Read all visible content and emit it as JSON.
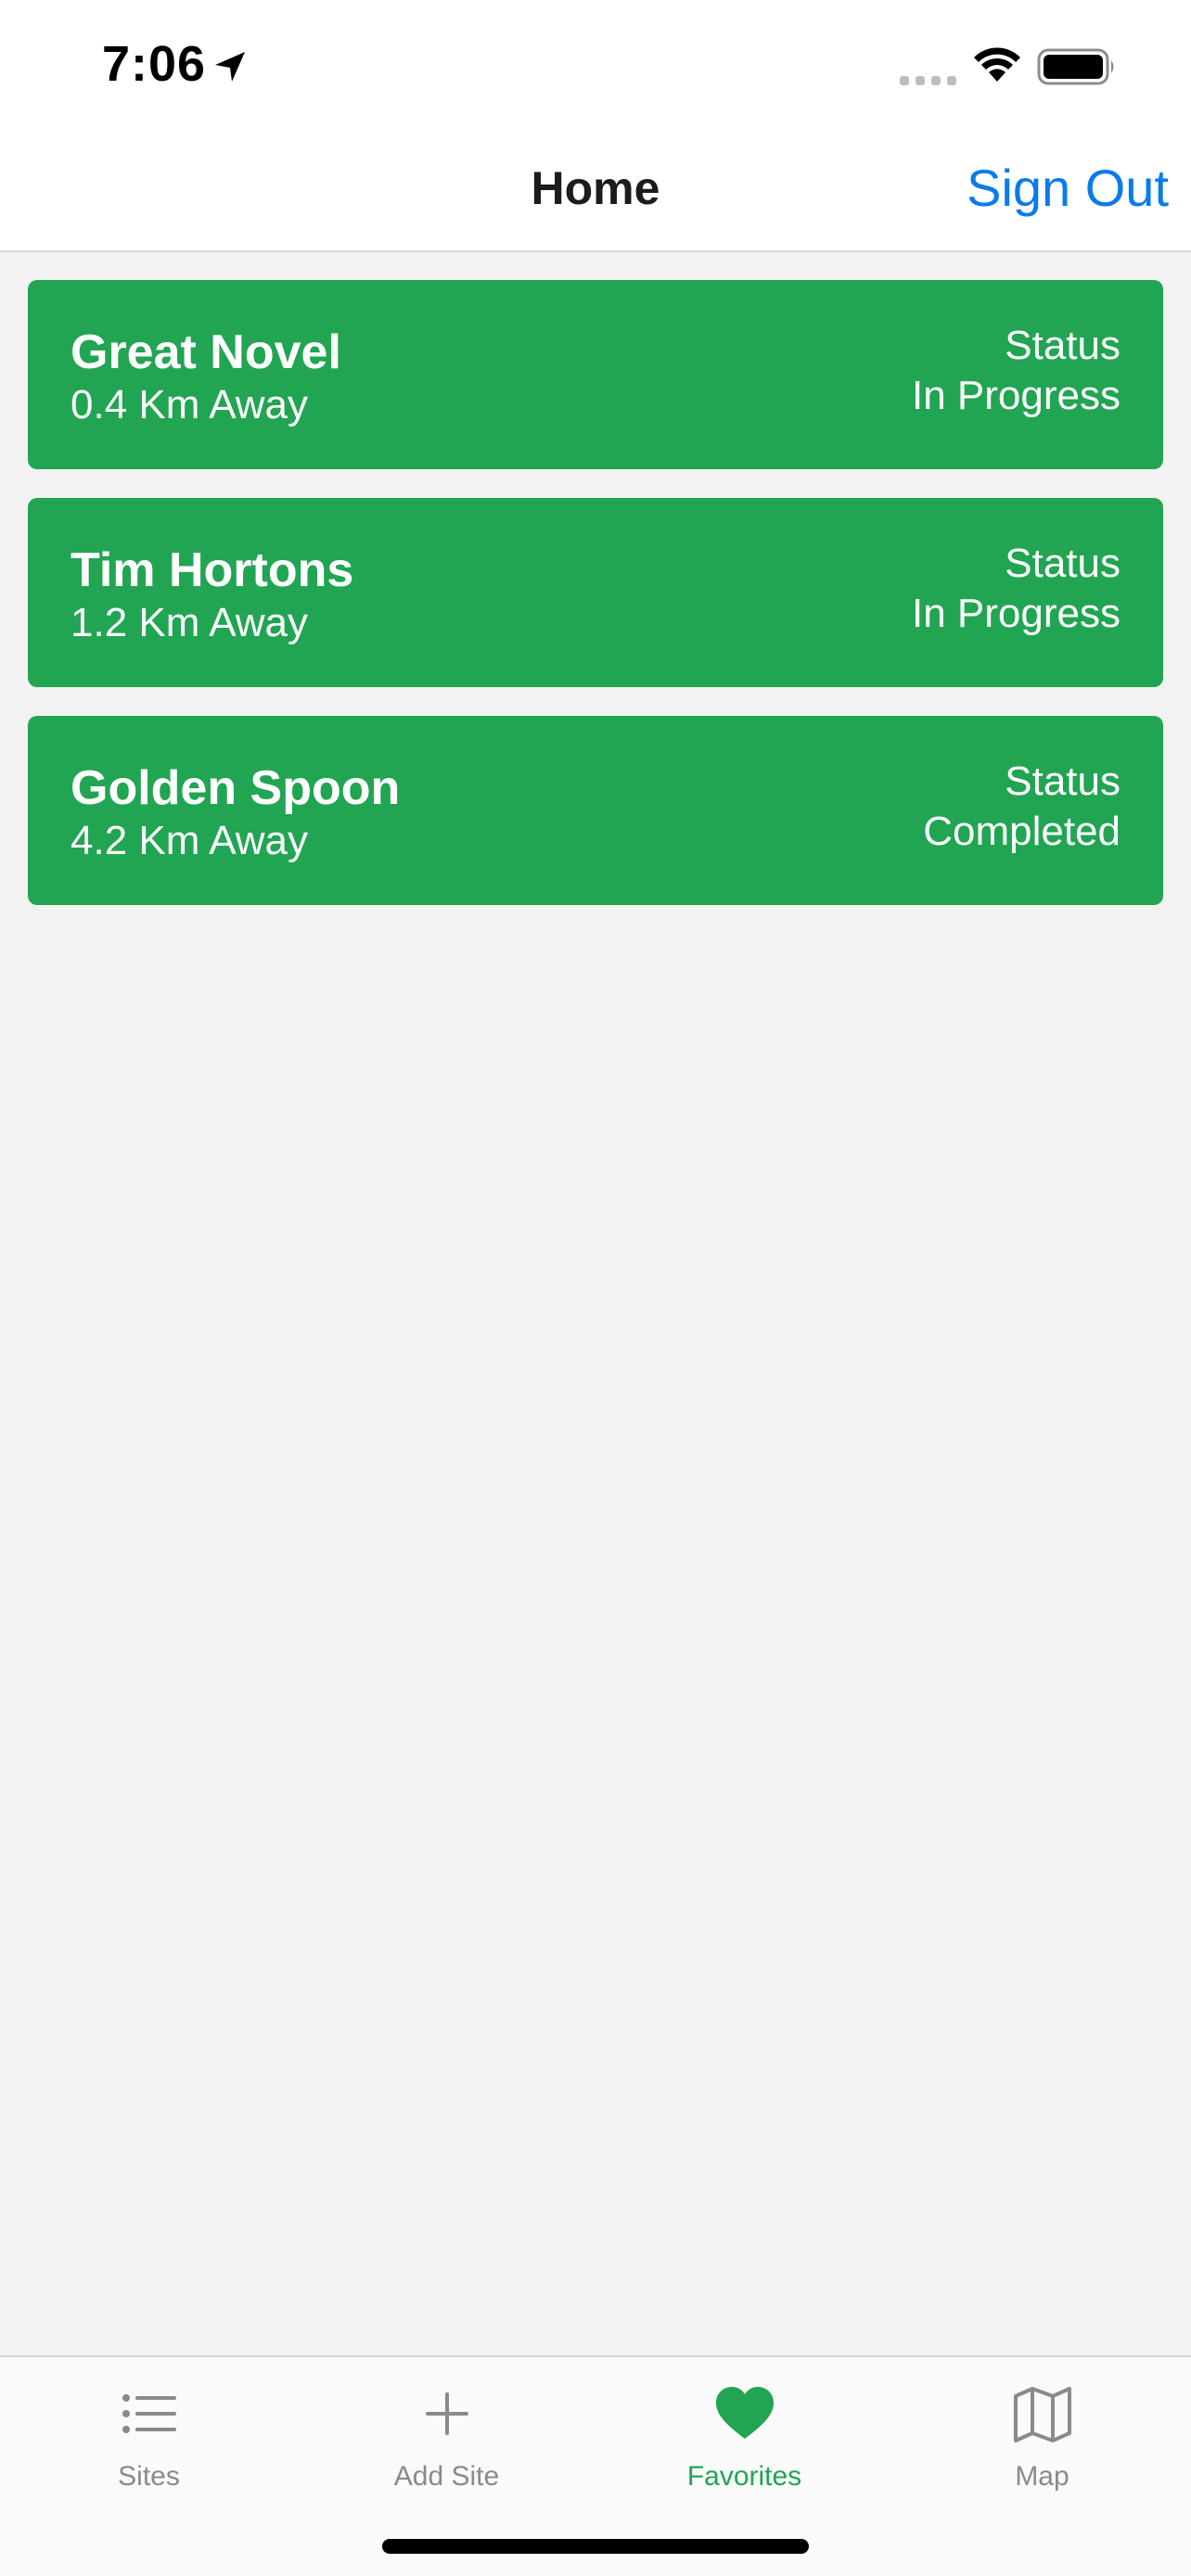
{
  "status_bar": {
    "time": "7:06"
  },
  "nav": {
    "title": "Home",
    "sign_out_label": "Sign Out"
  },
  "sites": [
    {
      "name": "Great Novel",
      "distance": "0.4 Km Away",
      "status_label": "Status",
      "status": "In Progress"
    },
    {
      "name": "Tim Hortons",
      "distance": "1.2 Km Away",
      "status_label": "Status",
      "status": "In Progress"
    },
    {
      "name": "Golden Spoon",
      "distance": "4.2 Km Away",
      "status_label": "Status",
      "status": "Completed"
    }
  ],
  "tabs": [
    {
      "label": "Sites",
      "icon": "list-icon",
      "active": false
    },
    {
      "label": "Add Site",
      "icon": "plus-icon",
      "active": false
    },
    {
      "label": "Favorites",
      "icon": "heart-icon",
      "active": true
    },
    {
      "label": "Map",
      "icon": "map-icon",
      "active": false
    }
  ],
  "colors": {
    "card_green": "#21a552",
    "link_blue": "#0a7bea",
    "tab_inactive": "#8a8a8a",
    "background": "#f2f2f2"
  }
}
